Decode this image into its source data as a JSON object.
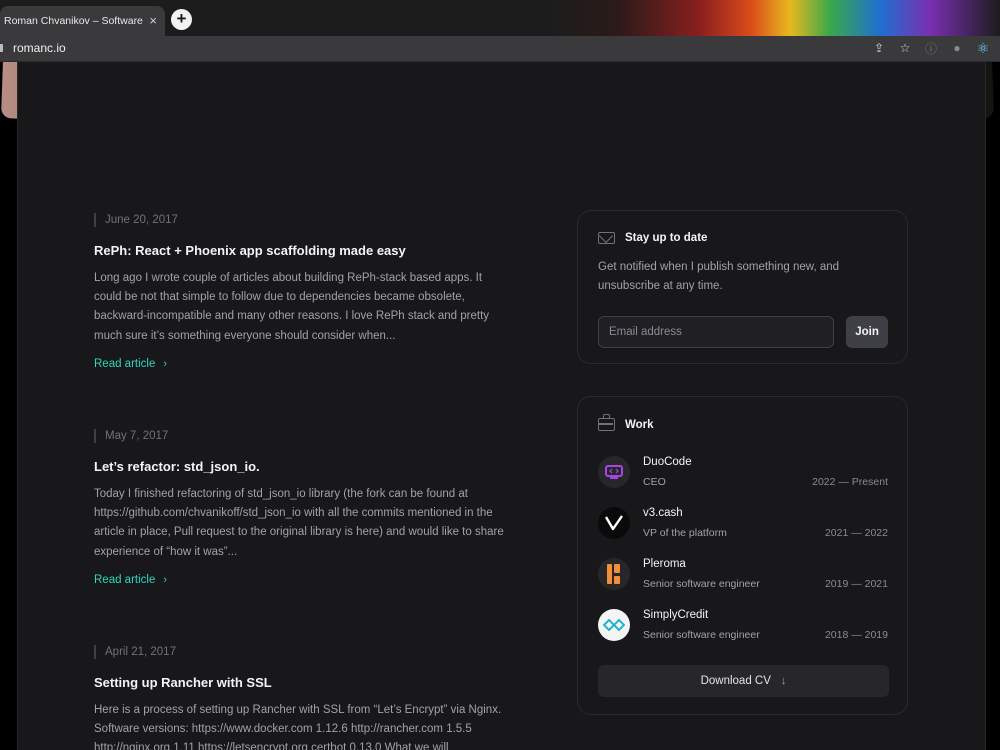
{
  "browser": {
    "tab_title": "Roman Chvanikov – Software e",
    "tab_close": "×",
    "new_tab": "+",
    "url": "romanc.io"
  },
  "articles": [
    {
      "date": "June 20, 2017",
      "title": "RePh: React + Phoenix app scaffolding made easy",
      "body": "Long ago I wrote couple of articles about building RePh-stack based apps. It could be not that simple to follow due to dependencies became obsolete, backward-incompatible and many other reasons. I love RePh stack and pretty much sure it’s something everyone should consider when...",
      "read_label": "Read article"
    },
    {
      "date": "May 7, 2017",
      "title": "Let’s refactor: std_json_io.",
      "body": "Today I finished refactoring of std_json_io library (the fork can be found at https://github.com/chvanikoff/std_json_io with all the commits mentioned in the article in place, Pull request to the original library is here) and would like to share experience of “how it was”...",
      "read_label": "Read article"
    },
    {
      "date": "April 21, 2017",
      "title": "Setting up Rancher with SSL",
      "body": "Here is a process of setting up Rancher with SSL from “Let’s Encrypt” via Nginx. Software versions: https://www.docker.com 1.12.6 http://rancher.com 1.5.5 http://nginx.org 1.11 https://letsencrypt.org certbot 0.13.0 What we will",
      "read_label": "Read article"
    }
  ],
  "newsletter": {
    "title": "Stay up to date",
    "text": "Get notified when I publish something new, and unsubscribe at any time.",
    "placeholder": "Email address",
    "button": "Join"
  },
  "work": {
    "title": "Work",
    "jobs": [
      {
        "company": "DuoCode",
        "role": "CEO",
        "dates": "2022 — Present"
      },
      {
        "company": "v3.cash",
        "role": "VP of the platform",
        "dates": "2021 — 2022"
      },
      {
        "company": "Pleroma",
        "role": "Senior software engineer",
        "dates": "2019 — 2021"
      },
      {
        "company": "SimplyCredit",
        "role": "Senior software engineer",
        "dates": "2018 — 2019"
      }
    ],
    "download_label": "Download CV",
    "download_arrow": "↓"
  },
  "icons": {
    "read_chevron": "›",
    "share": "⇪",
    "star": "☆",
    "info": "ⓘ",
    "ext_puzzle": "●",
    "react": "⚛"
  },
  "colors": {
    "accent": "#2dd4bf",
    "background": "#18181b",
    "duocode": "#8b2fc9",
    "pleroma": "#f28f3b",
    "simplycredit": "#1fb5c9"
  }
}
